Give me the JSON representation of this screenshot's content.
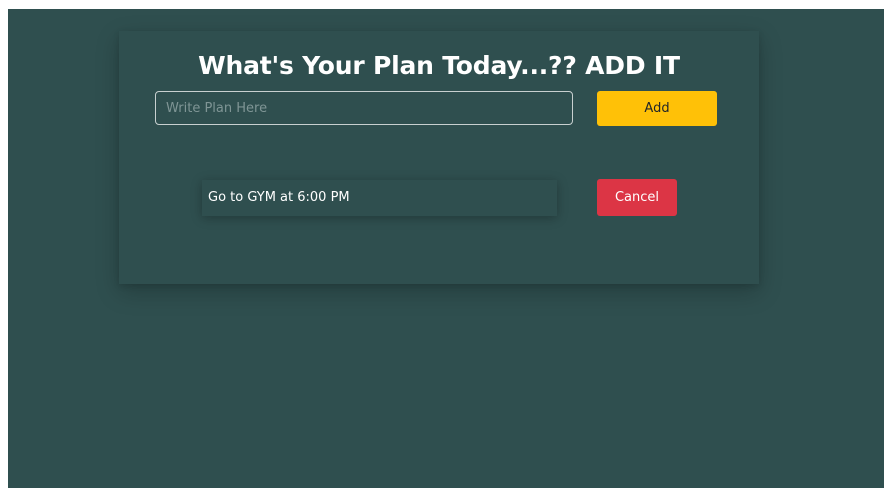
{
  "app": {
    "title": "What's Your Plan Today...?? ADD IT"
  },
  "form": {
    "input_value": "",
    "input_placeholder": "Write Plan Here",
    "add_label": "Add"
  },
  "tasks": [
    {
      "text": "Go to GYM at 6:00 PM",
      "cancel_label": "Cancel"
    }
  ],
  "colors": {
    "background": "#2f4f4f",
    "add_button": "#ffc107",
    "cancel_button": "#dc3545",
    "text": "#ffffff"
  }
}
